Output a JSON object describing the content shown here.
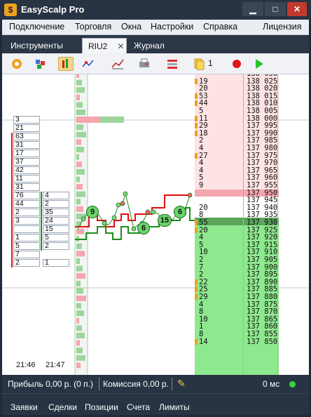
{
  "app": {
    "title": "EasyScalp Pro",
    "icon_glyph": "$",
    "min_glyph": "▁",
    "max_glyph": "□",
    "close_glyph": "✕"
  },
  "menu": [
    "Подключение",
    "Торговля",
    "Окна",
    "Настройки",
    "Справка",
    "Лицензия"
  ],
  "tabs": {
    "instruments": "Инструменты",
    "active": "RIU2",
    "close": "✕",
    "journal": "Журнал"
  },
  "toolbar": {
    "order_count": "1"
  },
  "ladder": {
    "top_partial": "138 030",
    "asks": [
      {
        "vol": "19",
        "price": "138 025"
      },
      {
        "vol": "20",
        "price": "138 020"
      },
      {
        "vol": "53",
        "price": "138 015"
      },
      {
        "vol": "44",
        "price": "138 010"
      },
      {
        "vol": "5",
        "price": "138 005"
      },
      {
        "vol": "11",
        "price": "138 000"
      },
      {
        "vol": "29",
        "price": "137 995"
      },
      {
        "vol": "18",
        "price": "137 990"
      },
      {
        "vol": "2",
        "price": "137 985"
      },
      {
        "vol": "4",
        "price": "137 980"
      },
      {
        "vol": "27",
        "price": "137 975"
      },
      {
        "vol": "4",
        "price": "137 970"
      },
      {
        "vol": "4",
        "price": "137 965"
      },
      {
        "vol": "5",
        "price": "137 960"
      },
      {
        "vol": "9",
        "price": "137 955"
      }
    ],
    "spread": [
      "137 950",
      "137 945"
    ],
    "bids": [
      {
        "vol": "20",
        "price": "137 940"
      },
      {
        "vol": "8",
        "price": "137 935"
      },
      {
        "vol": "55",
        "price": "137 930"
      },
      {
        "vol": "20",
        "price": "137 925"
      },
      {
        "vol": "4",
        "price": "137 920"
      },
      {
        "vol": "5",
        "price": "137 915"
      },
      {
        "vol": "10",
        "price": "137 910"
      },
      {
        "vol": "2",
        "price": "137 905"
      },
      {
        "vol": "7",
        "price": "137 900"
      },
      {
        "vol": "2",
        "price": "137 895"
      },
      {
        "vol": "22",
        "price": "137 890"
      },
      {
        "vol": "25",
        "price": "137 885"
      },
      {
        "vol": "29",
        "price": "137 880"
      },
      {
        "vol": "4",
        "price": "137 875"
      },
      {
        "vol": "8",
        "price": "137 870"
      },
      {
        "vol": "10",
        "price": "137 865"
      },
      {
        "vol": "1",
        "price": "137 860"
      },
      {
        "vol": "8",
        "price": "137 855"
      },
      {
        "vol": "14",
        "price": "137 850"
      }
    ]
  },
  "cluster_left": [
    "3",
    "21",
    "63",
    "31",
    "17",
    "37",
    "42",
    "11",
    "31",
    "76",
    "44",
    "2",
    "3",
    "",
    "1",
    "5",
    "7",
    "2"
  ],
  "cluster_right": [
    "4",
    "2",
    "35",
    "24",
    "15",
    "5",
    "2",
    "1"
  ],
  "trade_bubbles": [
    "9",
    "6",
    "15",
    "6"
  ],
  "times": [
    "21:46",
    "21:47"
  ],
  "status": {
    "profit": "Прибыль 0,00 р. (0 п.)",
    "commission": "Комиссия 0,00 р.",
    "latency": "0 мс"
  },
  "bottom_tabs": [
    "Заявки",
    "Сделки",
    "Позиции",
    "Счета",
    "Лимиты"
  ],
  "colors": {
    "ask_bg": "#fde3e3",
    "bid_bg": "#8ee88e",
    "accent": "#f0a020",
    "chart_red": "#e01010",
    "chart_green": "#1e8c1e"
  }
}
